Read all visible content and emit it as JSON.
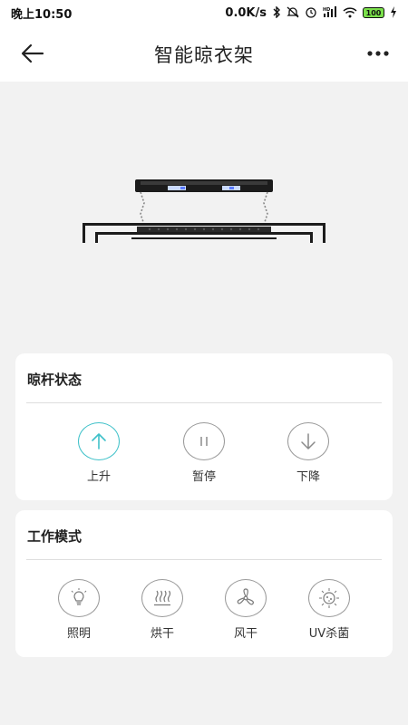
{
  "status_bar": {
    "time": "晚上10:50",
    "network_speed": "0.0K/s",
    "signal_label": "HD",
    "battery": "100"
  },
  "header": {
    "title": "智能晾衣架"
  },
  "rod_status": {
    "title": "晾杆状态",
    "actions": [
      {
        "label": "上升",
        "icon": "arrow-up-icon",
        "active": true
      },
      {
        "label": "暂停",
        "icon": "pause-icon",
        "active": false
      },
      {
        "label": "下降",
        "icon": "arrow-down-icon",
        "active": false
      }
    ]
  },
  "work_mode": {
    "title": "工作模式",
    "modes": [
      {
        "label": "照明",
        "icon": "light-bulb-icon"
      },
      {
        "label": "烘干",
        "icon": "heat-dry-icon"
      },
      {
        "label": "风干",
        "icon": "fan-icon"
      },
      {
        "label": "UV杀菌",
        "icon": "uv-sterilize-icon"
      }
    ]
  },
  "colors": {
    "accent": "#3fc1c9",
    "background": "#f2f2f2",
    "card": "#ffffff",
    "icon_stroke": "#9a9a9a"
  }
}
